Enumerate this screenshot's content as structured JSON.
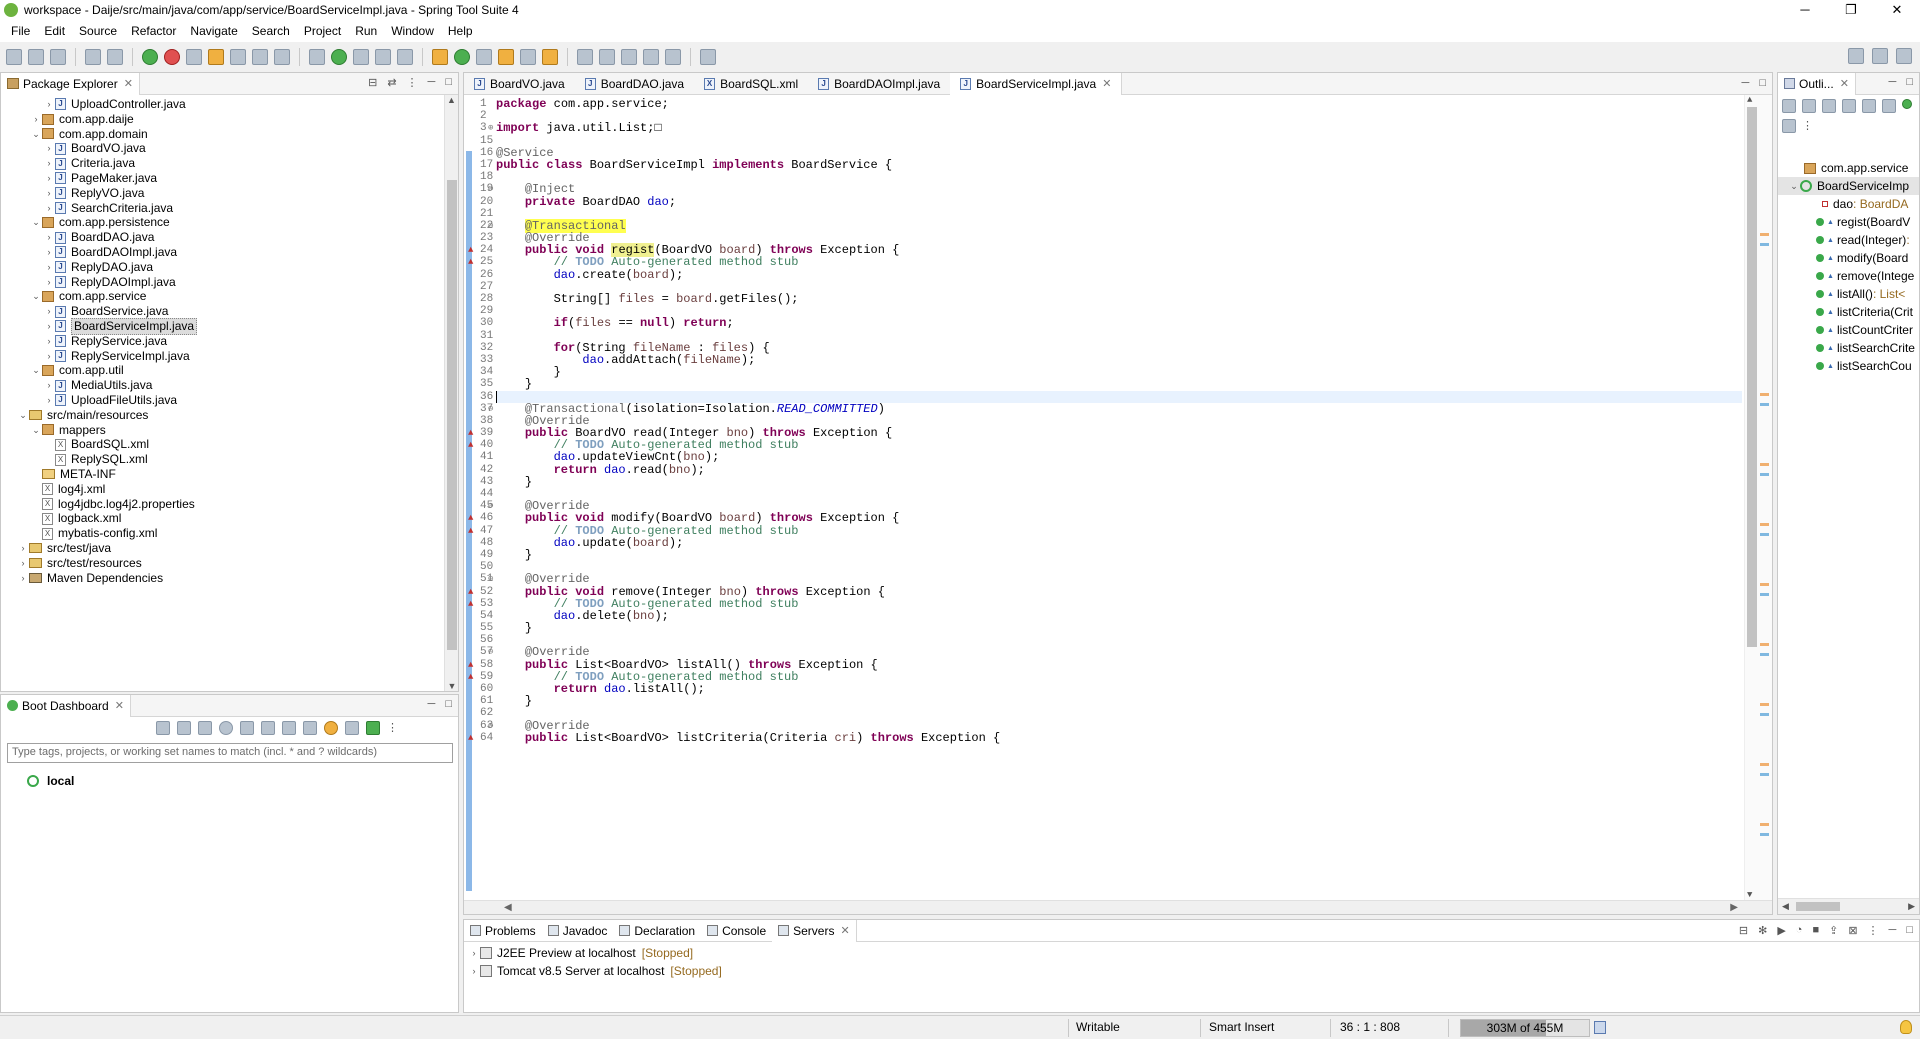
{
  "window": {
    "title": "workspace - Daije/src/main/java/com/app/service/BoardServiceImpl.java - Spring Tool Suite 4",
    "minimize": "─",
    "maximize": "❐",
    "close": "✕"
  },
  "menu": [
    "File",
    "Edit",
    "Source",
    "Refactor",
    "Navigate",
    "Search",
    "Project",
    "Run",
    "Window",
    "Help"
  ],
  "package_explorer": {
    "title": "Package Explorer",
    "items": [
      {
        "label": "UploadController.java",
        "depth": 3,
        "icon": "java",
        "arrow": ">"
      },
      {
        "label": "com.app.daije",
        "depth": 2,
        "icon": "pkg",
        "arrow": ">"
      },
      {
        "label": "com.app.domain",
        "depth": 2,
        "icon": "pkg",
        "arrow": "v"
      },
      {
        "label": "BoardVO.java",
        "depth": 3,
        "icon": "java",
        "arrow": ">"
      },
      {
        "label": "Criteria.java",
        "depth": 3,
        "icon": "java",
        "arrow": ">"
      },
      {
        "label": "PageMaker.java",
        "depth": 3,
        "icon": "java",
        "arrow": ">"
      },
      {
        "label": "ReplyVO.java",
        "depth": 3,
        "icon": "java",
        "arrow": ">"
      },
      {
        "label": "SearchCriteria.java",
        "depth": 3,
        "icon": "java",
        "arrow": ">"
      },
      {
        "label": "com.app.persistence",
        "depth": 2,
        "icon": "pkg",
        "arrow": "v"
      },
      {
        "label": "BoardDAO.java",
        "depth": 3,
        "icon": "java",
        "arrow": ">"
      },
      {
        "label": "BoardDAOImpl.java",
        "depth": 3,
        "icon": "java",
        "arrow": ">"
      },
      {
        "label": "ReplyDAO.java",
        "depth": 3,
        "icon": "java",
        "arrow": ">"
      },
      {
        "label": "ReplyDAOImpl.java",
        "depth": 3,
        "icon": "java",
        "arrow": ">"
      },
      {
        "label": "com.app.service",
        "depth": 2,
        "icon": "pkg",
        "arrow": "v"
      },
      {
        "label": "BoardService.java",
        "depth": 3,
        "icon": "java",
        "arrow": ">"
      },
      {
        "label": "BoardServiceImpl.java",
        "depth": 3,
        "icon": "java",
        "arrow": ">",
        "selected": true
      },
      {
        "label": "ReplyService.java",
        "depth": 3,
        "icon": "java",
        "arrow": ">"
      },
      {
        "label": "ReplyServiceImpl.java",
        "depth": 3,
        "icon": "java",
        "arrow": ">"
      },
      {
        "label": "com.app.util",
        "depth": 2,
        "icon": "pkg",
        "arrow": "v"
      },
      {
        "label": "MediaUtils.java",
        "depth": 3,
        "icon": "java",
        "arrow": ">"
      },
      {
        "label": "UploadFileUtils.java",
        "depth": 3,
        "icon": "java",
        "arrow": ">"
      },
      {
        "label": "src/main/resources",
        "depth": 1,
        "icon": "src",
        "arrow": "v"
      },
      {
        "label": "mappers",
        "depth": 2,
        "icon": "pkg",
        "arrow": "v"
      },
      {
        "label": "BoardSQL.xml",
        "depth": 3,
        "icon": "xml",
        "arrow": ""
      },
      {
        "label": "ReplySQL.xml",
        "depth": 3,
        "icon": "xml",
        "arrow": ""
      },
      {
        "label": "META-INF",
        "depth": 2,
        "icon": "folder",
        "arrow": ""
      },
      {
        "label": "log4j.xml",
        "depth": 2,
        "icon": "xml",
        "arrow": ""
      },
      {
        "label": "log4jdbc.log4j2.properties",
        "depth": 2,
        "icon": "xml",
        "arrow": ""
      },
      {
        "label": "logback.xml",
        "depth": 2,
        "icon": "xml",
        "arrow": ""
      },
      {
        "label": "mybatis-config.xml",
        "depth": 2,
        "icon": "xml",
        "arrow": ""
      },
      {
        "label": "src/test/java",
        "depth": 1,
        "icon": "src",
        "arrow": ">"
      },
      {
        "label": "src/test/resources",
        "depth": 1,
        "icon": "src",
        "arrow": ">"
      },
      {
        "label": "Maven Dependencies",
        "depth": 1,
        "icon": "lib",
        "arrow": ">"
      }
    ]
  },
  "boot_dashboard": {
    "title": "Boot Dashboard",
    "filter_placeholder": "Type tags, projects, or working set names to match (incl. * and ? wildcards)",
    "local_label": "local"
  },
  "editor_tabs": [
    {
      "label": "BoardVO.java",
      "active": false
    },
    {
      "label": "BoardDAO.java",
      "active": false
    },
    {
      "label": "BoardSQL.xml",
      "active": false
    },
    {
      "label": "BoardDAOImpl.java",
      "active": false
    },
    {
      "label": "BoardServiceImpl.java",
      "active": true
    }
  ],
  "code_lines": [
    {
      "n": "1",
      "t": "package com.app.service;"
    },
    {
      "n": "2",
      "t": ""
    },
    {
      "n": "3",
      "t": "import java.util.List;□",
      "fold": "⊕"
    },
    {
      "n": "15",
      "t": ""
    },
    {
      "n": "16",
      "t": "@Service"
    },
    {
      "n": "17",
      "t": "public class BoardServiceImpl implements BoardService {"
    },
    {
      "n": "18",
      "t": ""
    },
    {
      "n": "19",
      "t": "    @Inject",
      "fold": "⊖"
    },
    {
      "n": "20",
      "t": "    private BoardDAO dao;"
    },
    {
      "n": "21",
      "t": ""
    },
    {
      "n": "22",
      "t": "    @Transactional",
      "fold": "⊖"
    },
    {
      "n": "23",
      "t": "    @Override"
    },
    {
      "n": "24",
      "t": "    public void regist(BoardVO board) throws Exception {",
      "mark": true
    },
    {
      "n": "25",
      "t": "        // TODO Auto-generated method stub",
      "mark": true
    },
    {
      "n": "26",
      "t": "        dao.create(board);"
    },
    {
      "n": "27",
      "t": ""
    },
    {
      "n": "28",
      "t": "        String[] files = board.getFiles();"
    },
    {
      "n": "29",
      "t": ""
    },
    {
      "n": "30",
      "t": "        if(files == null) return;"
    },
    {
      "n": "31",
      "t": ""
    },
    {
      "n": "32",
      "t": "        for(String fileName : files) {"
    },
    {
      "n": "33",
      "t": "            dao.addAttach(fileName);"
    },
    {
      "n": "34",
      "t": "        }"
    },
    {
      "n": "35",
      "t": "    }"
    },
    {
      "n": "36",
      "t": "",
      "cur": true
    },
    {
      "n": "37",
      "t": "    @Transactional(isolation=Isolation.READ_COMMITTED)",
      "fold": "⊖"
    },
    {
      "n": "38",
      "t": "    @Override"
    },
    {
      "n": "39",
      "t": "    public BoardVO read(Integer bno) throws Exception {",
      "mark": true
    },
    {
      "n": "40",
      "t": "        // TODO Auto-generated method stub",
      "mark": true
    },
    {
      "n": "41",
      "t": "        dao.updateViewCnt(bno);"
    },
    {
      "n": "42",
      "t": "        return dao.read(bno);"
    },
    {
      "n": "43",
      "t": "    }"
    },
    {
      "n": "44",
      "t": ""
    },
    {
      "n": "45",
      "t": "    @Override",
      "fold": "⊖"
    },
    {
      "n": "46",
      "t": "    public void modify(BoardVO board) throws Exception {",
      "mark": true
    },
    {
      "n": "47",
      "t": "        // TODO Auto-generated method stub",
      "mark": true
    },
    {
      "n": "48",
      "t": "        dao.update(board);"
    },
    {
      "n": "49",
      "t": "    }"
    },
    {
      "n": "50",
      "t": ""
    },
    {
      "n": "51",
      "t": "    @Override",
      "fold": "⊖"
    },
    {
      "n": "52",
      "t": "    public void remove(Integer bno) throws Exception {",
      "mark": true
    },
    {
      "n": "53",
      "t": "        // TODO Auto-generated method stub",
      "mark": true
    },
    {
      "n": "54",
      "t": "        dao.delete(bno);"
    },
    {
      "n": "55",
      "t": "    }"
    },
    {
      "n": "56",
      "t": ""
    },
    {
      "n": "57",
      "t": "    @Override",
      "fold": "⊖"
    },
    {
      "n": "58",
      "t": "    public List<BoardVO> listAll() throws Exception {",
      "mark": true
    },
    {
      "n": "59",
      "t": "        // TODO Auto-generated method stub",
      "mark": true
    },
    {
      "n": "60",
      "t": "        return dao.listAll();"
    },
    {
      "n": "61",
      "t": "    }"
    },
    {
      "n": "62",
      "t": ""
    },
    {
      "n": "63",
      "t": "    @Override",
      "fold": "⊖"
    },
    {
      "n": "64",
      "t": "    public List<BoardVO> listCriteria(Criteria cri) throws Exception {",
      "mark": true
    }
  ],
  "outline": {
    "title": "Outli...",
    "items": [
      {
        "label": "com.app.service",
        "type": "pkg",
        "detail": ""
      },
      {
        "label": "BoardServiceImp",
        "type": "class",
        "detail": ""
      },
      {
        "label": "dao",
        "type": "field",
        "detail": " : BoardDA"
      },
      {
        "label": "regist(BoardV",
        "type": "method",
        "detail": ""
      },
      {
        "label": "read(Integer)",
        "type": "method",
        "detail": " :"
      },
      {
        "label": "modify(Board",
        "type": "method",
        "detail": ""
      },
      {
        "label": "remove(Intege",
        "type": "method",
        "detail": ""
      },
      {
        "label": "listAll()",
        "type": "method",
        "detail": " : List<"
      },
      {
        "label": "listCriteria(Crit",
        "type": "method",
        "detail": ""
      },
      {
        "label": "listCountCriter",
        "type": "method",
        "detail": ""
      },
      {
        "label": "listSearchCrite",
        "type": "method",
        "detail": ""
      },
      {
        "label": "listSearchCou",
        "type": "method",
        "detail": ""
      }
    ]
  },
  "bottom_tabs": [
    {
      "label": "Problems",
      "active": false
    },
    {
      "label": "Javadoc",
      "active": false
    },
    {
      "label": "Declaration",
      "active": false
    },
    {
      "label": "Console",
      "active": false
    },
    {
      "label": "Servers",
      "active": true
    }
  ],
  "servers": [
    {
      "name": "J2EE Preview at localhost",
      "state": "[Stopped]"
    },
    {
      "name": "Tomcat v8.5 Server at localhost",
      "state": "[Stopped]"
    }
  ],
  "status": {
    "writable": "Writable",
    "insert_mode": "Smart Insert",
    "position": "36 : 1 : 808",
    "heap": "303M of 455M",
    "heap_used_fraction": 0.666
  }
}
